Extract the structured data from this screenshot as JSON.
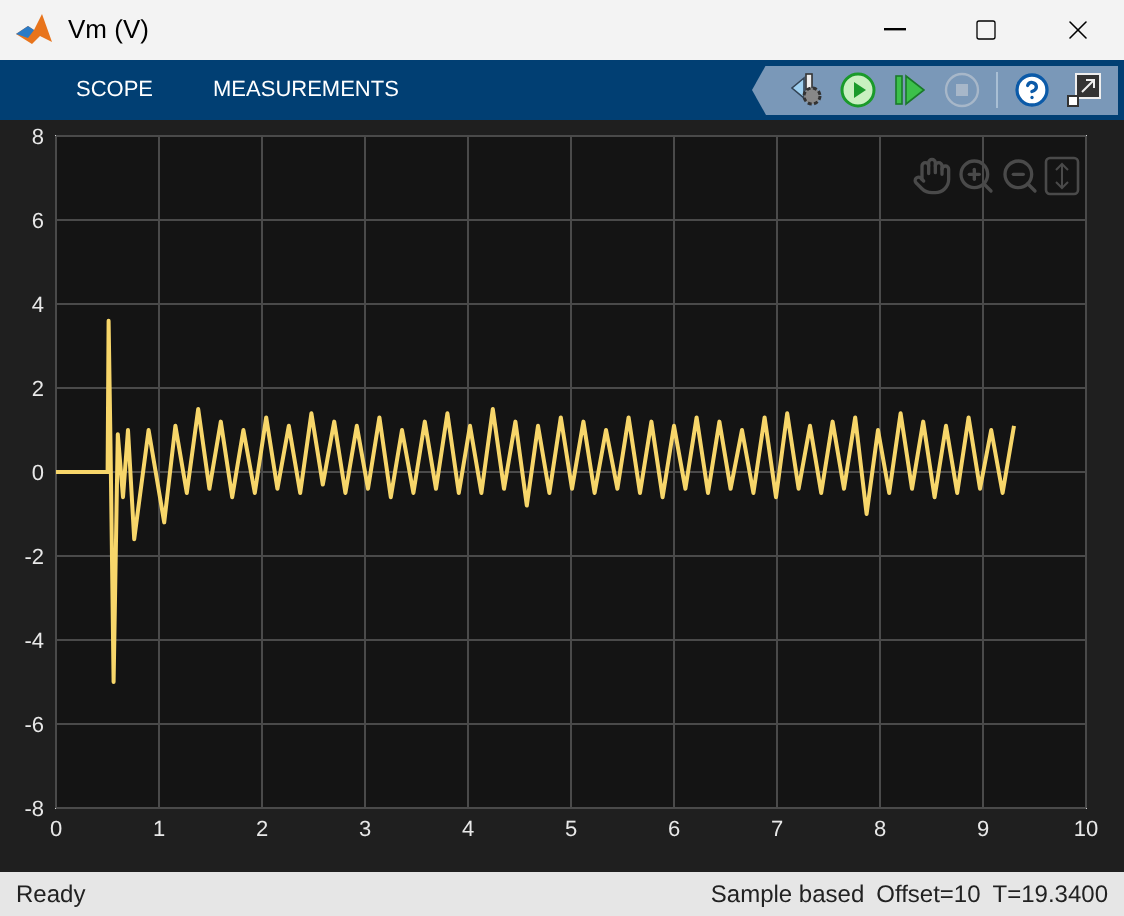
{
  "window": {
    "title": "Vm (V)"
  },
  "tabs": [
    {
      "label": "SCOPE",
      "selected": false
    },
    {
      "label": "MEASUREMENTS",
      "selected": false
    }
  ],
  "toolbar": {
    "stop_disabled": true
  },
  "plot": {
    "chart_data": {
      "type": "line",
      "xlim": [
        0,
        10
      ],
      "ylim": [
        -8,
        8
      ],
      "xticks": [
        0,
        1,
        2,
        3,
        4,
        5,
        6,
        7,
        8,
        9,
        10
      ],
      "yticks": [
        -8,
        -6,
        -4,
        -2,
        0,
        2,
        4,
        6,
        8
      ],
      "grid": true,
      "x": [
        0,
        0.5,
        0.51,
        0.53,
        0.56,
        0.6,
        0.65,
        0.7,
        0.76,
        0.9,
        1.05,
        1.16,
        1.27,
        1.38,
        1.49,
        1.6,
        1.71,
        1.82,
        1.93,
        2.04,
        2.15,
        2.26,
        2.37,
        2.48,
        2.59,
        2.7,
        2.81,
        2.92,
        3.03,
        3.14,
        3.25,
        3.36,
        3.47,
        3.58,
        3.69,
        3.8,
        3.91,
        4.02,
        4.13,
        4.24,
        4.35,
        4.46,
        4.57,
        4.68,
        4.79,
        4.9,
        5.01,
        5.12,
        5.23,
        5.34,
        5.45,
        5.56,
        5.67,
        5.78,
        5.89,
        6.0,
        6.11,
        6.22,
        6.33,
        6.44,
        6.55,
        6.66,
        6.77,
        6.88,
        6.99,
        7.1,
        7.21,
        7.32,
        7.43,
        7.54,
        7.65,
        7.76,
        7.87,
        7.98,
        8.09,
        8.2,
        8.31,
        8.42,
        8.53,
        8.64,
        8.75,
        8.86,
        8.97,
        9.08,
        9.19,
        9.3
      ],
      "series": [
        {
          "color": "#f7d66a",
          "values": [
            0,
            0,
            3.6,
            0.5,
            -5.0,
            0.9,
            -0.6,
            1.0,
            -1.6,
            1.0,
            -1.2,
            1.1,
            -0.5,
            1.5,
            -0.4,
            1.2,
            -0.6,
            1.0,
            -0.5,
            1.3,
            -0.4,
            1.1,
            -0.5,
            1.4,
            -0.3,
            1.2,
            -0.5,
            1.1,
            -0.4,
            1.3,
            -0.6,
            1.0,
            -0.5,
            1.2,
            -0.4,
            1.4,
            -0.5,
            1.1,
            -0.5,
            1.5,
            -0.4,
            1.2,
            -0.8,
            1.1,
            -0.5,
            1.3,
            -0.4,
            1.2,
            -0.5,
            1.0,
            -0.4,
            1.3,
            -0.5,
            1.2,
            -0.6,
            1.1,
            -0.4,
            1.3,
            -0.5,
            1.2,
            -0.4,
            1.0,
            -0.5,
            1.3,
            -0.6,
            1.4,
            -0.4,
            1.1,
            -0.5,
            1.2,
            -0.4,
            1.3,
            -1.0,
            1.0,
            -0.5,
            1.4,
            -0.4,
            1.2,
            -0.6,
            1.1,
            -0.5,
            1.3,
            -0.4,
            1.0,
            -0.5,
            1.1
          ]
        }
      ]
    }
  },
  "status_bar": {
    "left": "Ready",
    "right": [
      "Sample based",
      "Offset=10",
      "T=19.3400"
    ]
  }
}
